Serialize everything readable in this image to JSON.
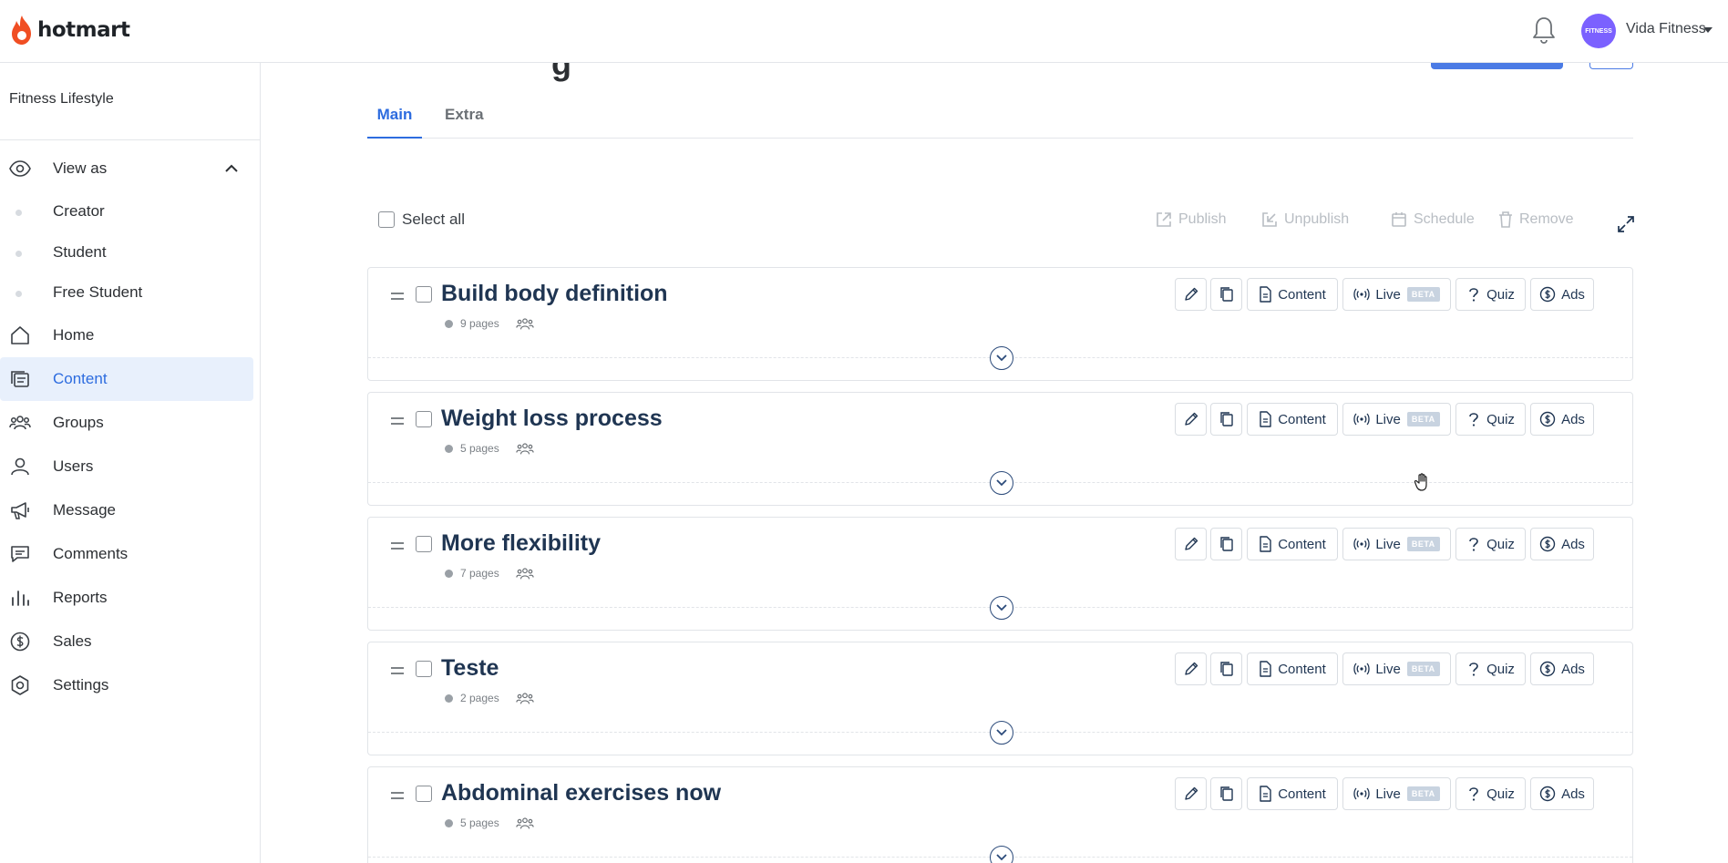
{
  "topbar": {
    "logo_text": "hotmart",
    "avatar_text": "FITNESS",
    "user_name": "Vida Fitness"
  },
  "sidebar": {
    "course_title": "Fitness Lifestyle",
    "view_as": "View as",
    "view_options": [
      "Creator",
      "Student",
      "Free Student"
    ],
    "items": [
      {
        "label": "Home",
        "icon": "home-icon"
      },
      {
        "label": "Content",
        "icon": "content-icon",
        "active": true
      },
      {
        "label": "Groups",
        "icon": "groups-icon"
      },
      {
        "label": "Users",
        "icon": "user-icon"
      },
      {
        "label": "Message",
        "icon": "megaphone-icon"
      },
      {
        "label": "Comments",
        "icon": "comments-icon"
      },
      {
        "label": "Reports",
        "icon": "reports-icon"
      },
      {
        "label": "Sales",
        "icon": "dollar-icon"
      },
      {
        "label": "Settings",
        "icon": "settings-icon"
      }
    ]
  },
  "main": {
    "partial_title": "g",
    "tabs": [
      {
        "label": "Main",
        "active": true
      },
      {
        "label": "Extra",
        "active": false
      }
    ],
    "toolbar": {
      "select_all": "Select all",
      "publish": "Publish",
      "unpublish": "Unpublish",
      "schedule": "Schedule",
      "remove": "Remove"
    },
    "action_labels": {
      "content": "Content",
      "live": "Live",
      "beta": "BETA",
      "quiz": "Quiz",
      "ads": "Ads"
    },
    "modules": [
      {
        "title": "Build body definition",
        "pages": "9 pages"
      },
      {
        "title": "Weight loss process",
        "pages": "5 pages"
      },
      {
        "title": "More flexibility",
        "pages": "7 pages"
      },
      {
        "title": "Teste",
        "pages": "2 pages"
      },
      {
        "title": "Abdominal exercises now",
        "pages": "5 pages"
      }
    ]
  },
  "colors": {
    "accent": "#2d6cdf",
    "module_title": "#1f3552",
    "active_bg": "#e8f0fc",
    "brand_flame": "#f04e23"
  }
}
